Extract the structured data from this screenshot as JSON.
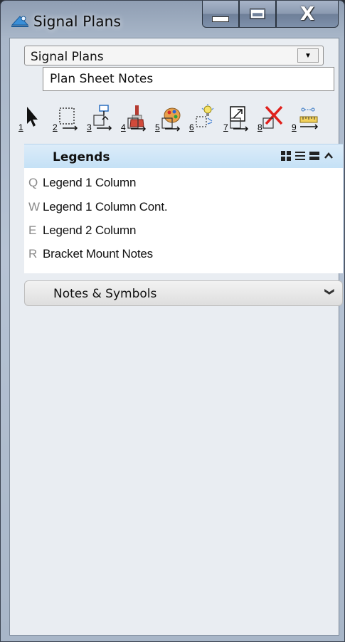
{
  "window": {
    "title": "Signal Plans",
    "close_glyph": "X"
  },
  "workflow_combo": {
    "selected": "Signal Plans",
    "dropdown_item": "Plan Sheet Notes"
  },
  "toolbar": {
    "tools": [
      {
        "num": "1",
        "icon": "arrow-select-icon"
      },
      {
        "num": "2",
        "icon": "dashed-select-icon"
      },
      {
        "num": "3",
        "icon": "place-cell-icon"
      },
      {
        "num": "4",
        "icon": "paintbrush-icon"
      },
      {
        "num": "5",
        "icon": "palette-icon"
      },
      {
        "num": "6",
        "icon": "lightbulb-icon"
      },
      {
        "num": "7",
        "icon": "scale-icon"
      },
      {
        "num": "8",
        "icon": "delete-x-icon"
      },
      {
        "num": "9",
        "icon": "measure-icon"
      }
    ]
  },
  "legends": {
    "title": "Legends",
    "items": [
      {
        "key": "Q",
        "label": "Legend 1 Column"
      },
      {
        "key": "W",
        "label": "Legend 1 Column Cont."
      },
      {
        "key": "E",
        "label": "Legend 2 Column"
      },
      {
        "key": "R",
        "label": "Bracket Mount Notes"
      }
    ]
  },
  "notes_symbols": {
    "title": "Notes & Symbols"
  },
  "colors": {
    "panel_header": "#c5e1f6",
    "delete_red": "#e0201c"
  }
}
